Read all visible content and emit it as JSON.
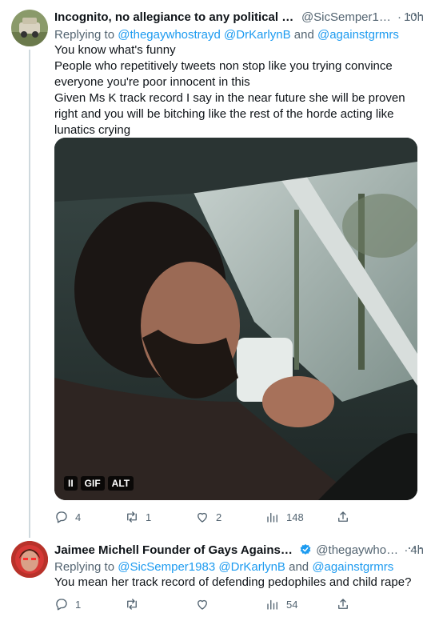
{
  "tweet1": {
    "display_name": "Incognito, no allegiance to any political p...",
    "handle": "@SicSemper19...",
    "separator": "·",
    "time": "10h",
    "more": "···",
    "replying_prefix": "Replying to",
    "replying_users": [
      "@thegaywhostrayd",
      "@DrKarlynB"
    ],
    "replying_and": "and",
    "replying_last": "@againstgrmrs",
    "lines": [
      "You know what's funny",
      "People who repetitively tweets non stop like you trying convince everyone you're poor innocent in this",
      "Given Ms K track record I say in the near future she will be proven right and you will be bitching like the rest of the horde acting like lunatics crying"
    ],
    "media": {
      "pause_label": "II",
      "gif_label": "GIF",
      "alt_label": "ALT"
    },
    "actions": {
      "replies": "4",
      "retweets": "1",
      "likes": "2",
      "views": "148"
    }
  },
  "tweet2": {
    "display_name": "Jaimee Michell Founder of Gays Against ...",
    "handle": "@thegaywhos...",
    "separator": "·",
    "time": "4h",
    "more": "···",
    "replying_prefix": "Replying to",
    "replying_users": [
      "@SicSemper1983",
      "@DrKarlynB"
    ],
    "replying_and": "and",
    "replying_last": "@againstgrmrs",
    "text": "You mean her track record of defending pedophiles and child rape?",
    "actions": {
      "replies": "1",
      "retweets": "",
      "likes": "",
      "views": "54"
    }
  },
  "colors": {
    "link": "#1d9bf0",
    "secondary": "#536471",
    "verified": "#1d9bf0",
    "thread_line": "#cfd9de"
  }
}
